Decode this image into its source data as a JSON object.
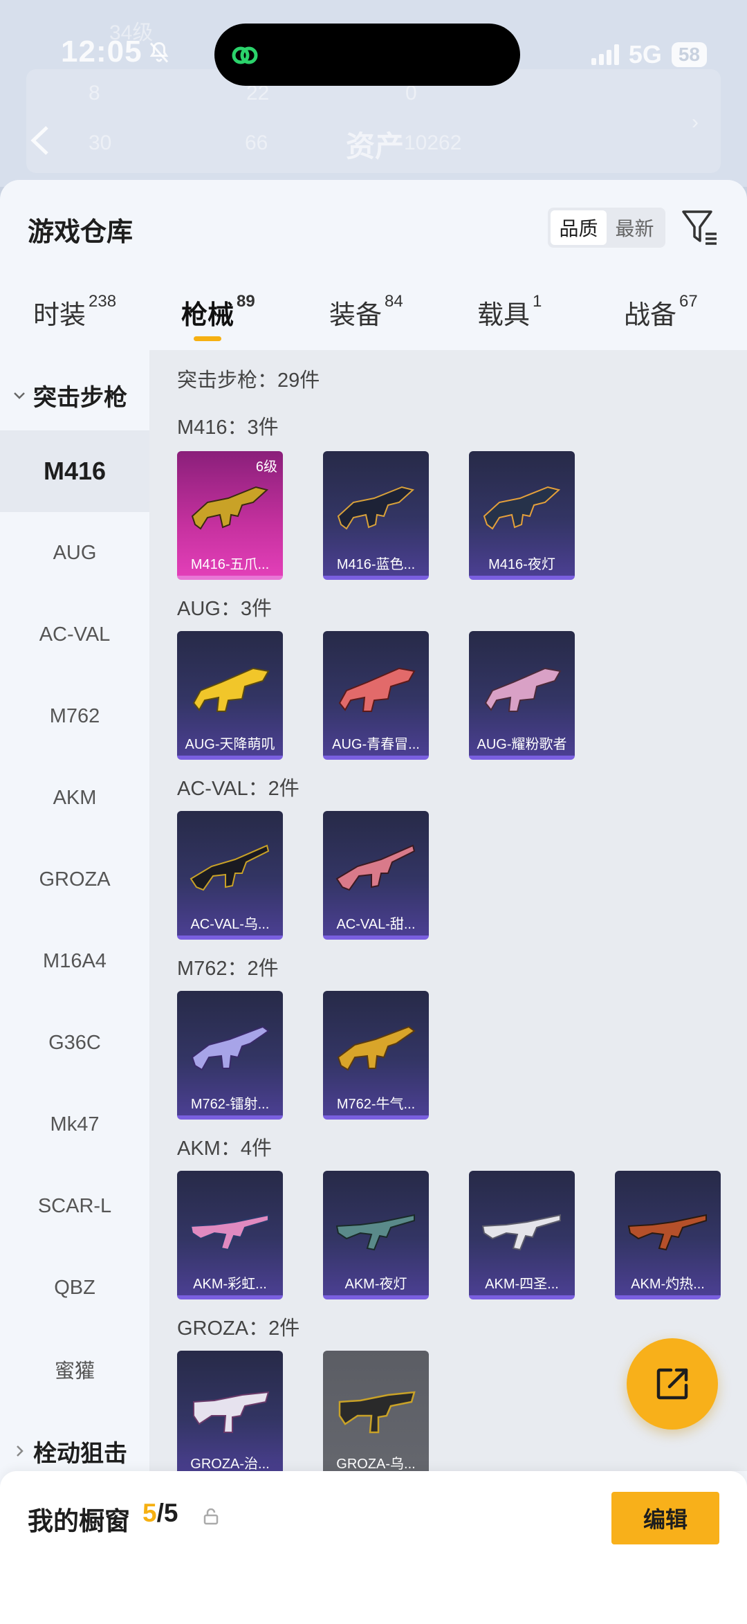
{
  "status_bar": {
    "time": "12:05",
    "network": "5G",
    "battery": "58"
  },
  "background_header": {
    "title": "资产",
    "faded_level": "34级",
    "faded_values": [
      "8",
      "22",
      "0",
      "30",
      "66",
      "10262"
    ]
  },
  "header": {
    "title": "游戏仓库",
    "sort_options": [
      "品质",
      "最新"
    ],
    "active_sort": "品质"
  },
  "tabs": [
    {
      "label": "时装",
      "count": "238"
    },
    {
      "label": "枪械",
      "count": "89"
    },
    {
      "label": "装备",
      "count": "84"
    },
    {
      "label": "载具",
      "count": "1"
    },
    {
      "label": "战备",
      "count": "67"
    }
  ],
  "sidebar": {
    "group_open": "突击步枪",
    "items": [
      "M416",
      "AUG",
      "AC-VAL",
      "M762",
      "AKM",
      "GROZA",
      "M16A4",
      "G36C",
      "Mk47",
      "SCAR-L",
      "QBZ",
      "蜜獾"
    ],
    "group_closed": "栓动狙击"
  },
  "content": {
    "summary": "突击步枪：29件",
    "sections": [
      {
        "label": "M416：3件",
        "items": [
          {
            "name": "M416-五爪...",
            "level": "6级",
            "rarity": "pink"
          },
          {
            "name": "M416-蓝色...",
            "rarity": "purple"
          },
          {
            "name": "M416-夜灯",
            "rarity": "purple"
          }
        ]
      },
      {
        "label": "AUG：3件",
        "items": [
          {
            "name": "AUG-天降萌叽",
            "rarity": "purple"
          },
          {
            "name": "AUG-青春冒...",
            "rarity": "purple"
          },
          {
            "name": "AUG-耀粉歌者",
            "rarity": "purple"
          }
        ]
      },
      {
        "label": "AC-VAL：2件",
        "items": [
          {
            "name": "AC-VAL-乌...",
            "rarity": "purple"
          },
          {
            "name": "AC-VAL-甜...",
            "rarity": "purple"
          }
        ]
      },
      {
        "label": "M762：2件",
        "items": [
          {
            "name": "M762-镭射...",
            "rarity": "purple"
          },
          {
            "name": "M762-牛气...",
            "rarity": "purple"
          }
        ]
      },
      {
        "label": "AKM：4件",
        "items": [
          {
            "name": "AKM-彩虹...",
            "rarity": "purple"
          },
          {
            "name": "AKM-夜灯",
            "rarity": "purple"
          },
          {
            "name": "AKM-四圣...",
            "rarity": "purple"
          },
          {
            "name": "AKM-灼热...",
            "rarity": "purple"
          }
        ]
      },
      {
        "label": "GROZA：2件",
        "items": [
          {
            "name": "GROZA-治...",
            "rarity": "purple"
          },
          {
            "name": "GROZA-乌...",
            "rarity": "grey"
          }
        ]
      }
    ]
  },
  "bottom_bar": {
    "title": "我的橱窗",
    "count_current": "5",
    "count_total": "/5",
    "edit_label": "编辑"
  },
  "colors": {
    "accent": "#f8b01a",
    "tab_underline": "#f6b012",
    "card_purple": "#333564",
    "card_pink": "#c6319f"
  }
}
